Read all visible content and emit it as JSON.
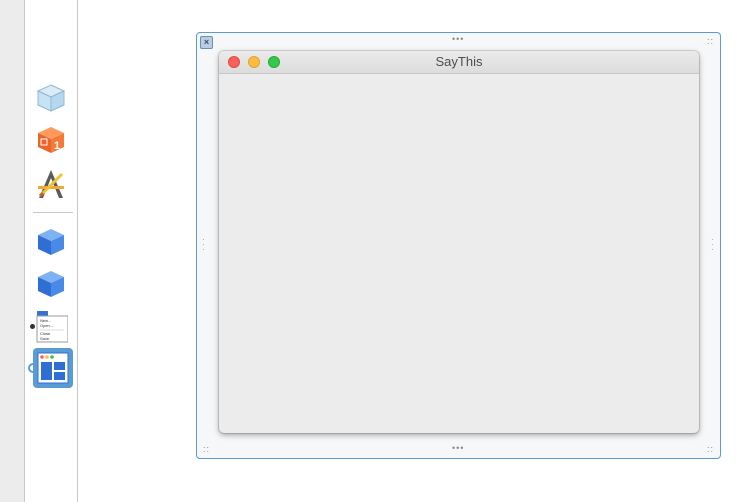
{
  "canvas": {
    "window": {
      "title": "SayThis"
    }
  },
  "dock": {
    "items": [
      {
        "name": "storyboard-icon"
      },
      {
        "name": "first-responder-icon"
      },
      {
        "name": "app-icon"
      },
      {
        "name": "object-cube-icon"
      },
      {
        "name": "object-cube-icon-2"
      },
      {
        "name": "main-menu-icon",
        "menu_lines": [
          "New...",
          "Open...",
          "Close",
          "Save"
        ]
      },
      {
        "name": "window-controller-icon"
      }
    ]
  },
  "colors": {
    "accent": "#5b9bd5",
    "close": "#fc605c",
    "minimize": "#fdbc40",
    "zoom": "#34c84a"
  }
}
